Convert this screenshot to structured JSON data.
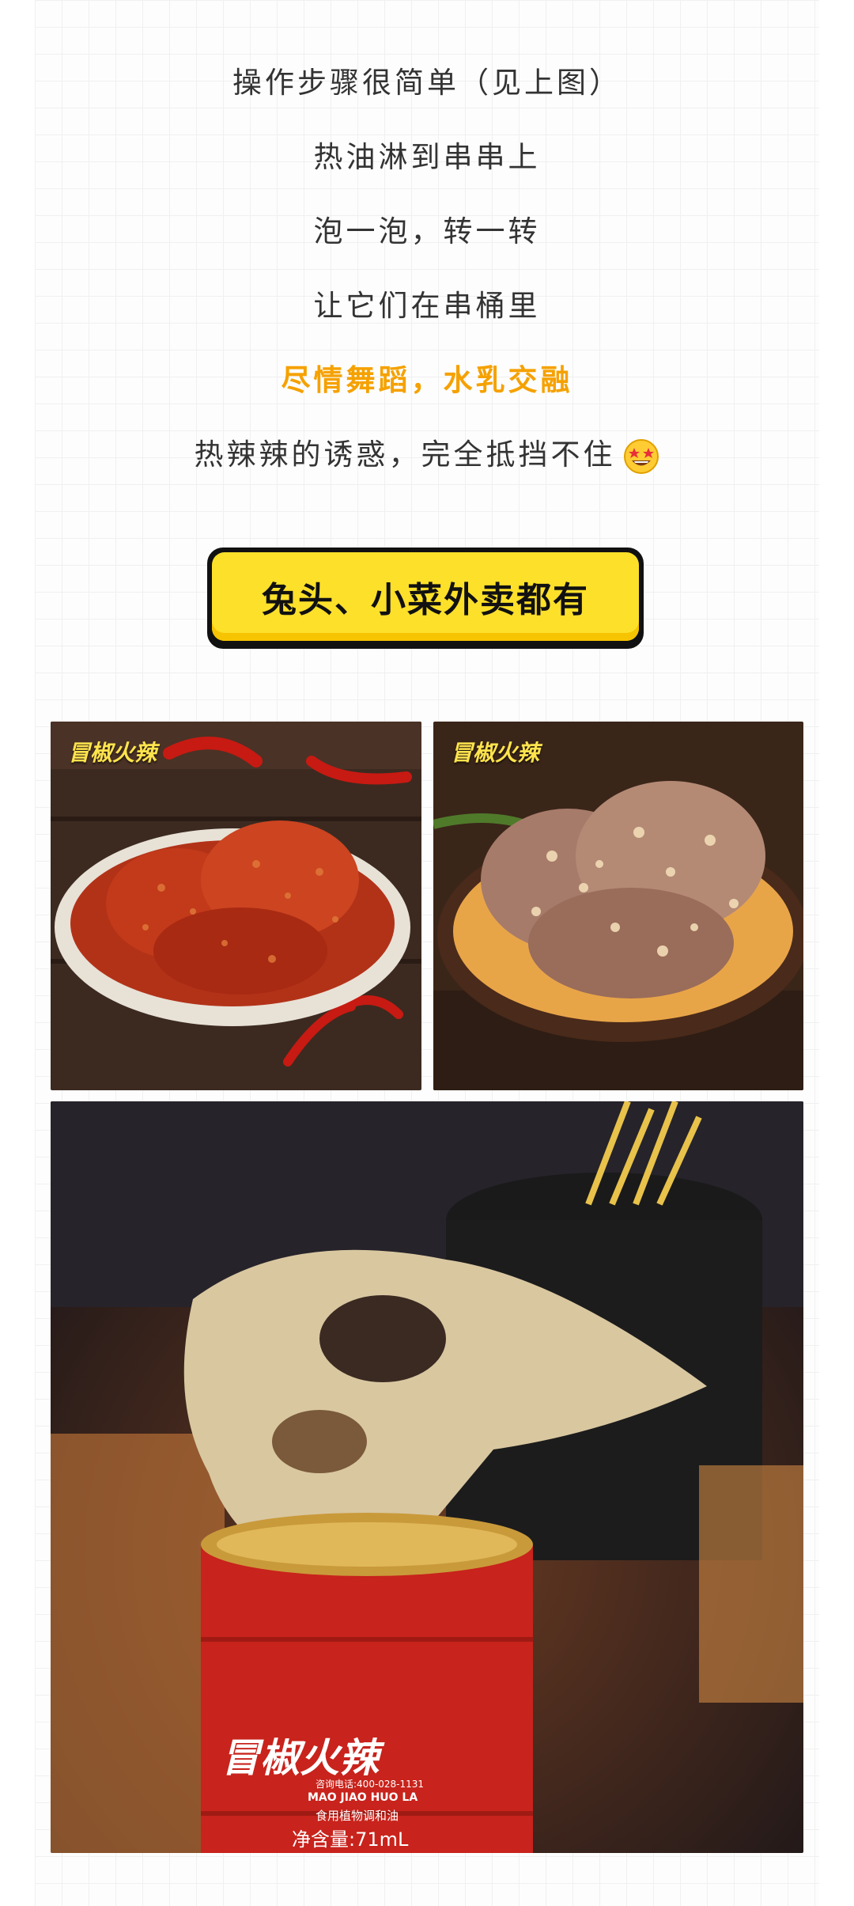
{
  "text_lines": [
    "操作步骤很简单（见上图）",
    "热油淋到串串上",
    "泡一泡，转一转",
    "让它们在串桶里",
    "尽情舞蹈，水乳交融",
    "热辣辣的诱惑，完全抵挡不住"
  ],
  "emoji": "star-eyes-emoji",
  "cta_button": {
    "label": "兔头、小菜外卖都有"
  },
  "photos": {
    "spicy_rabbit": {
      "logo": "冒椒火辣"
    },
    "garlic_rabbit": {
      "logo": "冒椒火辣"
    },
    "rabbit_head_can": {
      "brand": "冒椒火辣",
      "hotline": "咨询电话:400-028-1131",
      "pinyin": "MAO JIAO HUO LA",
      "product": "食用植物调和油",
      "net_content": "净含量:71mL"
    }
  },
  "colors": {
    "highlight": "#f5a100",
    "button_yellow": "#fde02a",
    "text": "#333333"
  }
}
